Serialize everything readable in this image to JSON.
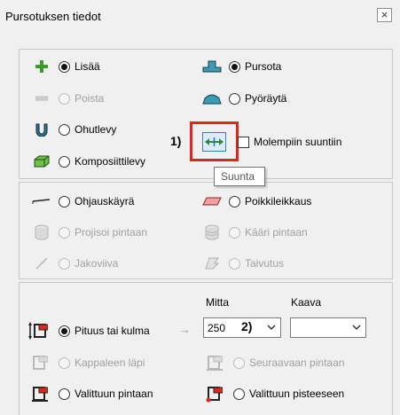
{
  "window": {
    "title": "Pursotuksen tiedot",
    "close_symbol": "×"
  },
  "operation": {
    "add": "Lisää",
    "remove": "Poista",
    "thin": "Ohutlevy",
    "composite": "Komposiittilevy",
    "extrude": "Pursota",
    "revolve": "Pyöräytä",
    "both_directions": "Molempiin suuntiin",
    "tooltip": "Suunta",
    "step1": "1)"
  },
  "path": {
    "guide_curve": "Ohjauskäyrä",
    "project_surface": "Projisoi pintaan",
    "split_line": "Jakoviiva",
    "cross_section": "Poikkileikkaus",
    "wrap_surface": "Kääri pintaan",
    "bend": "Taivutus"
  },
  "extent": {
    "dimension_header": "Mitta",
    "formula_header": "Kaava",
    "length_or_angle": "Pituus tai kulma",
    "through_part": "Kappaleen läpi",
    "to_selected_surface": "Valittuun pintaan",
    "to_next_surface": "Seuraavaan pintaan",
    "to_selected_point": "Valittuun pisteeseen",
    "dimension_value": "250",
    "formula_value": "",
    "step2": "2)",
    "arrow": "→"
  }
}
